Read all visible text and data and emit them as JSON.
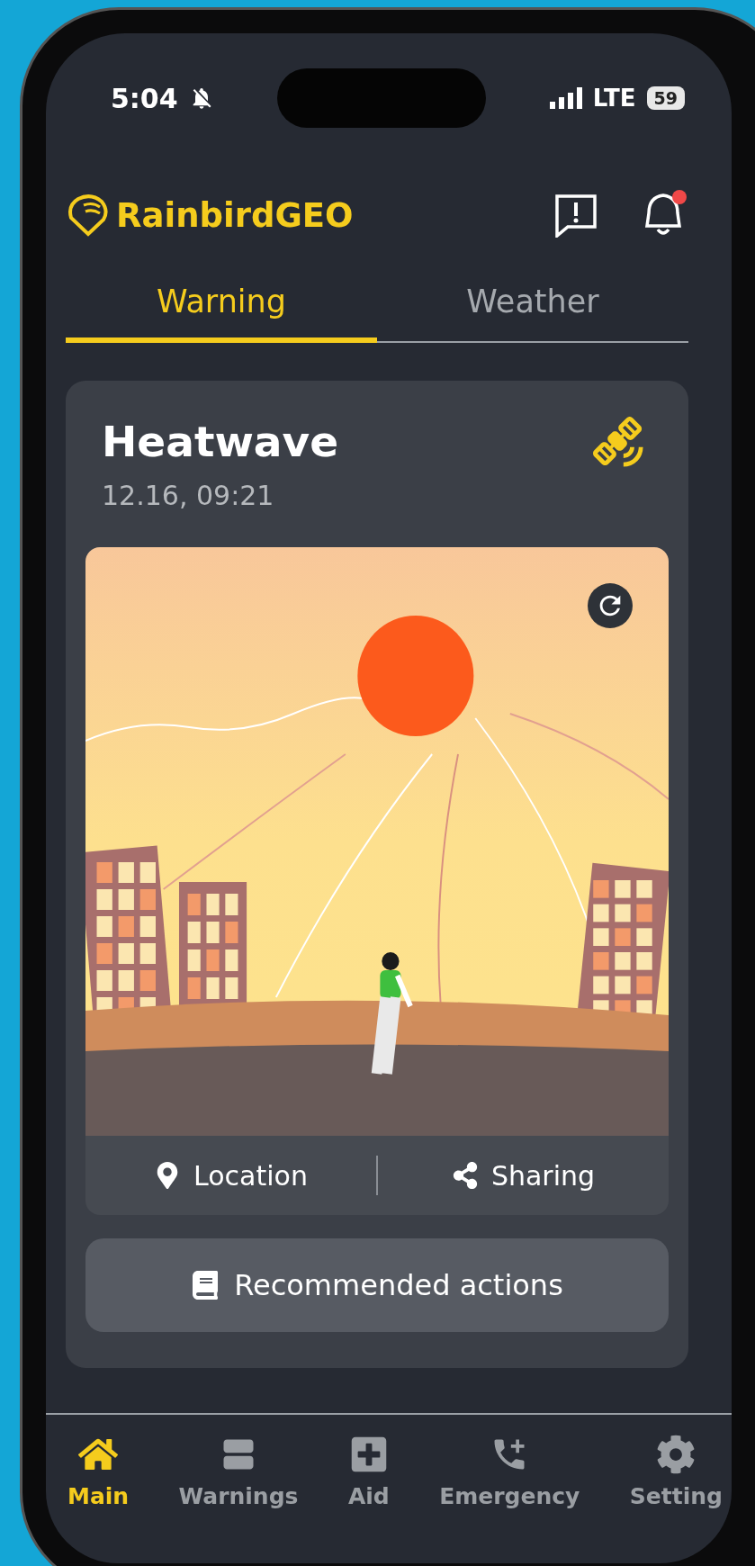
{
  "status_bar": {
    "time": "5:04",
    "network": "LTE",
    "battery": "59"
  },
  "header": {
    "app_name": "RainbirdGEO",
    "notification_dot": true
  },
  "tabs": [
    {
      "label": "Warning",
      "selected": true
    },
    {
      "label": "Weather",
      "selected": false
    }
  ],
  "warning_card": {
    "title": "Heatwave",
    "timestamp": "12.16, 09:21",
    "actions": [
      "Location",
      "Sharing"
    ],
    "recommended_button": "Recommended actions"
  },
  "bottom_nav": [
    {
      "label": "Main",
      "selected": true
    },
    {
      "label": "Warnings",
      "selected": false
    },
    {
      "label": "Aid",
      "selected": false
    },
    {
      "label": "Emergency",
      "selected": false
    },
    {
      "label": "Setting",
      "selected": false
    }
  ]
}
